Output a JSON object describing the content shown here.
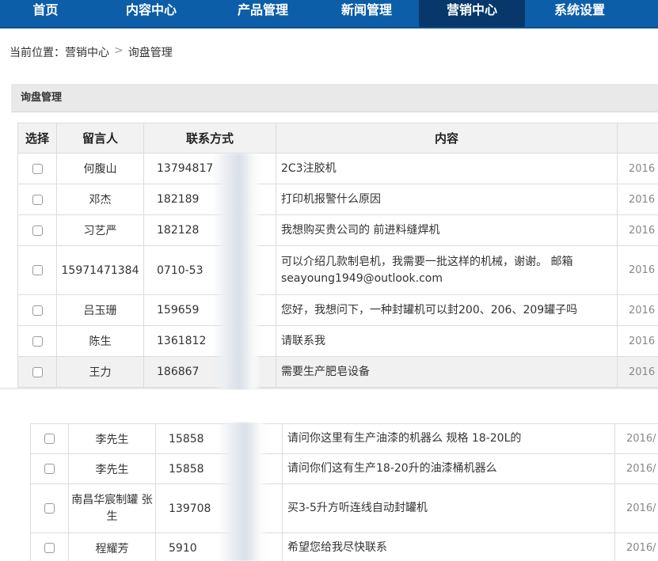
{
  "nav": {
    "items": [
      {
        "label": "首页"
      },
      {
        "label": "内容中心"
      },
      {
        "label": "产品管理"
      },
      {
        "label": "新闻管理"
      },
      {
        "label": "营销中心",
        "active": true
      },
      {
        "label": "系统设置"
      }
    ],
    "colors": {
      "bar": "#0d5ea8",
      "active": "#08386b"
    }
  },
  "breadcrumb": {
    "prefix": "当前位置：",
    "section": "营销中心",
    "separator": ">",
    "page": "询盘管理"
  },
  "panel": {
    "title": "询盘管理"
  },
  "table": {
    "headers": {
      "select": "选择",
      "sender": "留言人",
      "contact": "联系方式",
      "content": "内容"
    },
    "rows": [
      {
        "sender": "何腹山",
        "contact": "13794817",
        "content": "2C3注胶机",
        "date": "2016"
      },
      {
        "sender": "邓杰",
        "contact": "182189",
        "content": "打印机报警什么原因",
        "date": "2016"
      },
      {
        "sender": "习艺严",
        "contact": "182128",
        "content": "我想购买贵公司的 前进料缝焊机",
        "date": "2016"
      },
      {
        "sender": "15971471384",
        "contact": "0710-53",
        "content": "可以介绍几款制皂机，我需要一批这样的机械，谢谢。 邮箱 seayoung1949@outlook.com",
        "date": "2016"
      },
      {
        "sender": "吕玉珊",
        "contact": "159659",
        "content": "您好，我想问下，一种封罐机可以封200、206、209罐子吗",
        "date": "2016"
      },
      {
        "sender": "陈生",
        "contact": "1361812",
        "content": "请联系我",
        "date": "2016"
      },
      {
        "sender": "王力",
        "contact": "186867",
        "content": "需要生产肥皂设备",
        "date": "2016"
      }
    ],
    "rows2": [
      {
        "sender": "李先生",
        "contact": "15858",
        "content": "请问你这里有生产油漆的机器么 规格 18-20L的",
        "date": "2016/"
      },
      {
        "sender": "李先生",
        "contact": "15858",
        "content": "请问你们这有生产18-20升的油漆桶机器么",
        "date": "2016/"
      },
      {
        "sender": "南昌华宸制罐 张生",
        "contact": "139708",
        "content": "买3-5升方听连线自动封罐机",
        "date": "2016/"
      },
      {
        "sender": "程耀芳",
        "contact": "5910",
        "content": "希望您给我尽快联系",
        "date": "2016/"
      }
    ]
  }
}
